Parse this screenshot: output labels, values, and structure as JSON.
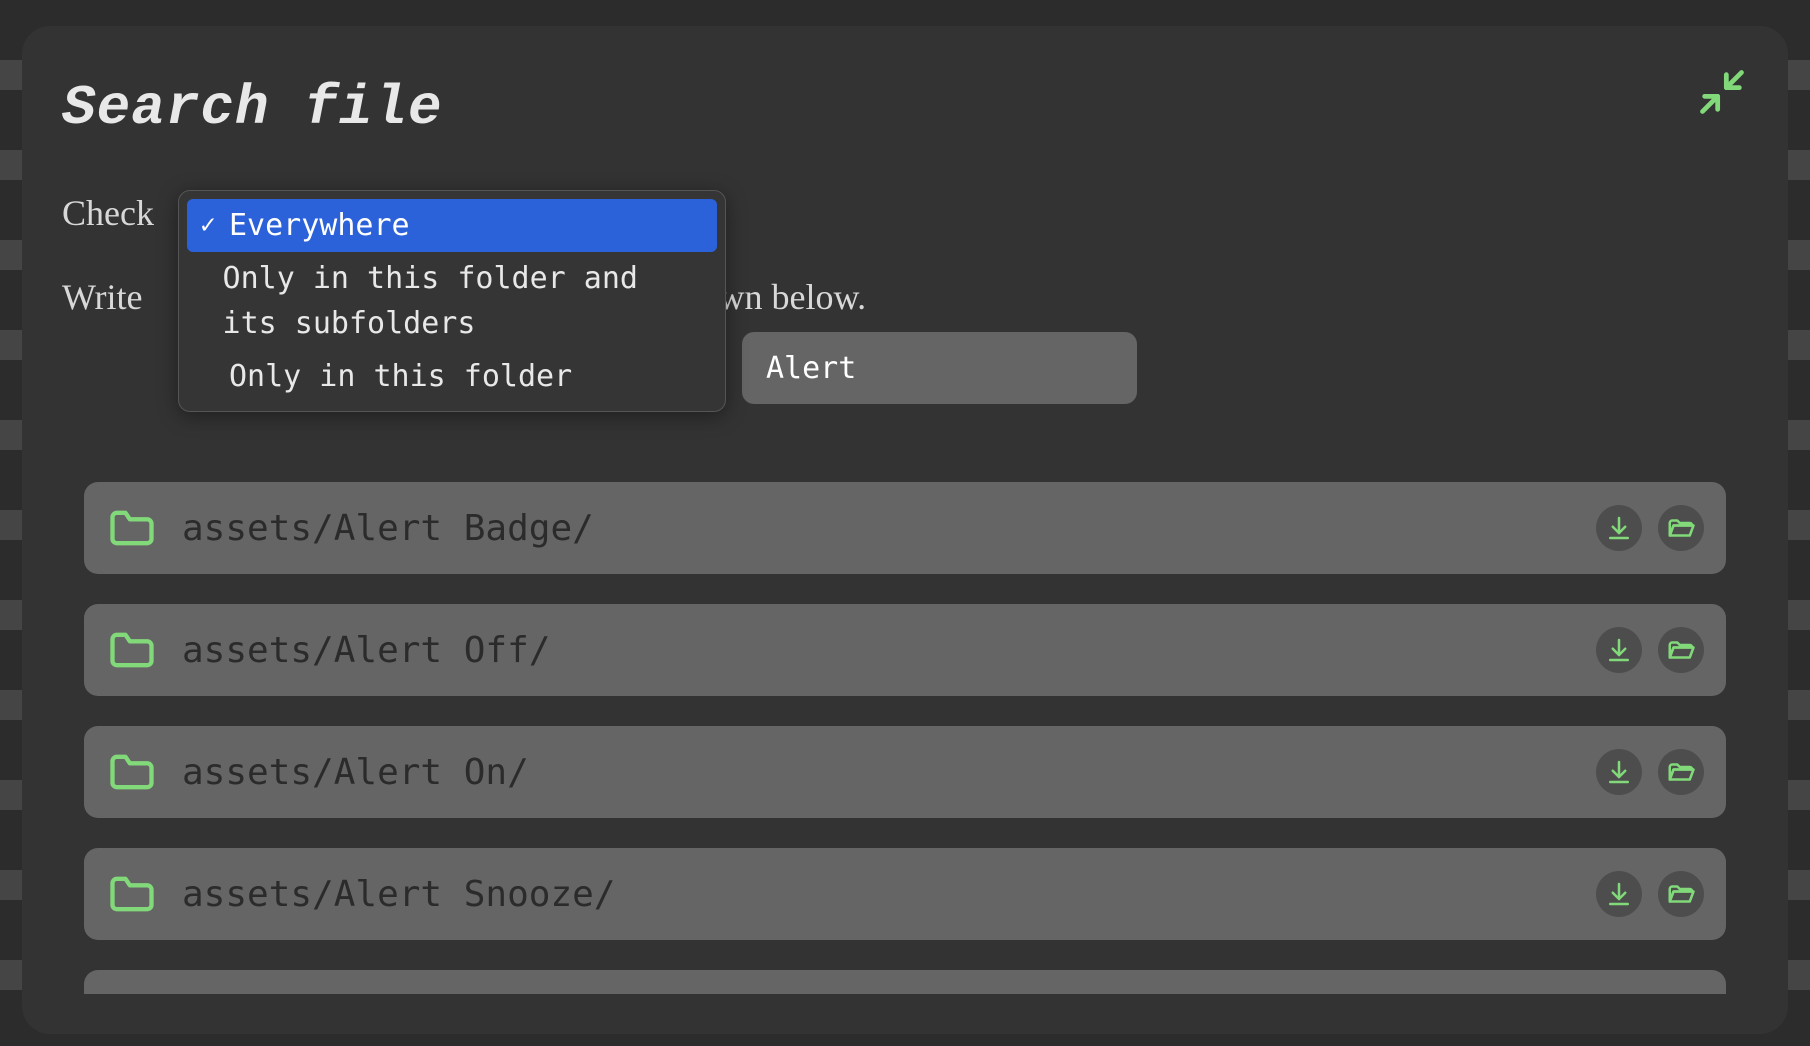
{
  "modal": {
    "title": "Search file",
    "instruction_prefix": "Check",
    "instruction2_prefix": "Write",
    "instruction2_suffix": "own below."
  },
  "dropdown": {
    "options": [
      {
        "label": "Everywhere",
        "selected": true
      },
      {
        "label": "Only in this folder and its subfolders",
        "selected": false
      },
      {
        "label": "Only in this folder",
        "selected": false
      }
    ]
  },
  "search": {
    "value": "Alert"
  },
  "results": [
    {
      "path": "assets/Alert Badge/"
    },
    {
      "path": "assets/Alert Off/"
    },
    {
      "path": "assets/Alert On/"
    },
    {
      "path": "assets/Alert Snooze/"
    }
  ],
  "colors": {
    "accent_green": "#82d97a",
    "highlight_blue": "#2b62d9"
  }
}
